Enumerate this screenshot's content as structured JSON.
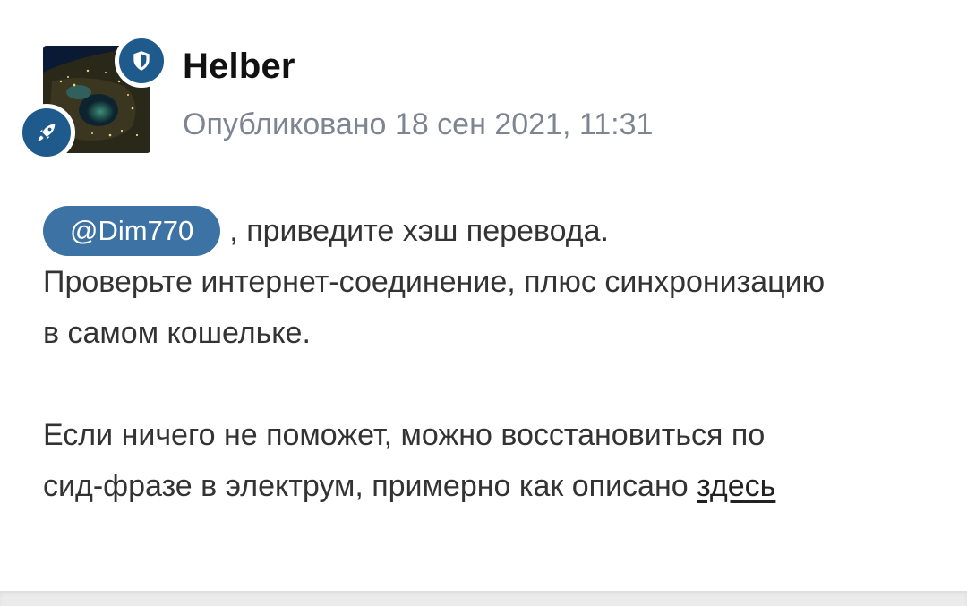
{
  "author": {
    "name": "Helber",
    "date_text": "Опубликовано 18 сен 2021, 11:31",
    "avatar_icon": "earth-night-satellite-avatar",
    "badges": [
      "shield-icon",
      "rocket-icon"
    ]
  },
  "post": {
    "mention": "@Dim770",
    "line1_rest": ", приведите хэш перевода.",
    "line2": "Проверьте интернет-соединение, плюс синхронизацию",
    "line3": "в самом кошельке.",
    "line4": "Если ничего не поможет, можно восстановиться по",
    "line5_text": "сид-фразе в электрум, примерно как описано ",
    "line5_link": "здесь"
  },
  "colors": {
    "badge": "#1f5a8c",
    "mention_bg": "#3d72a4",
    "date_text": "#7d8592",
    "body_text": "#333333"
  }
}
